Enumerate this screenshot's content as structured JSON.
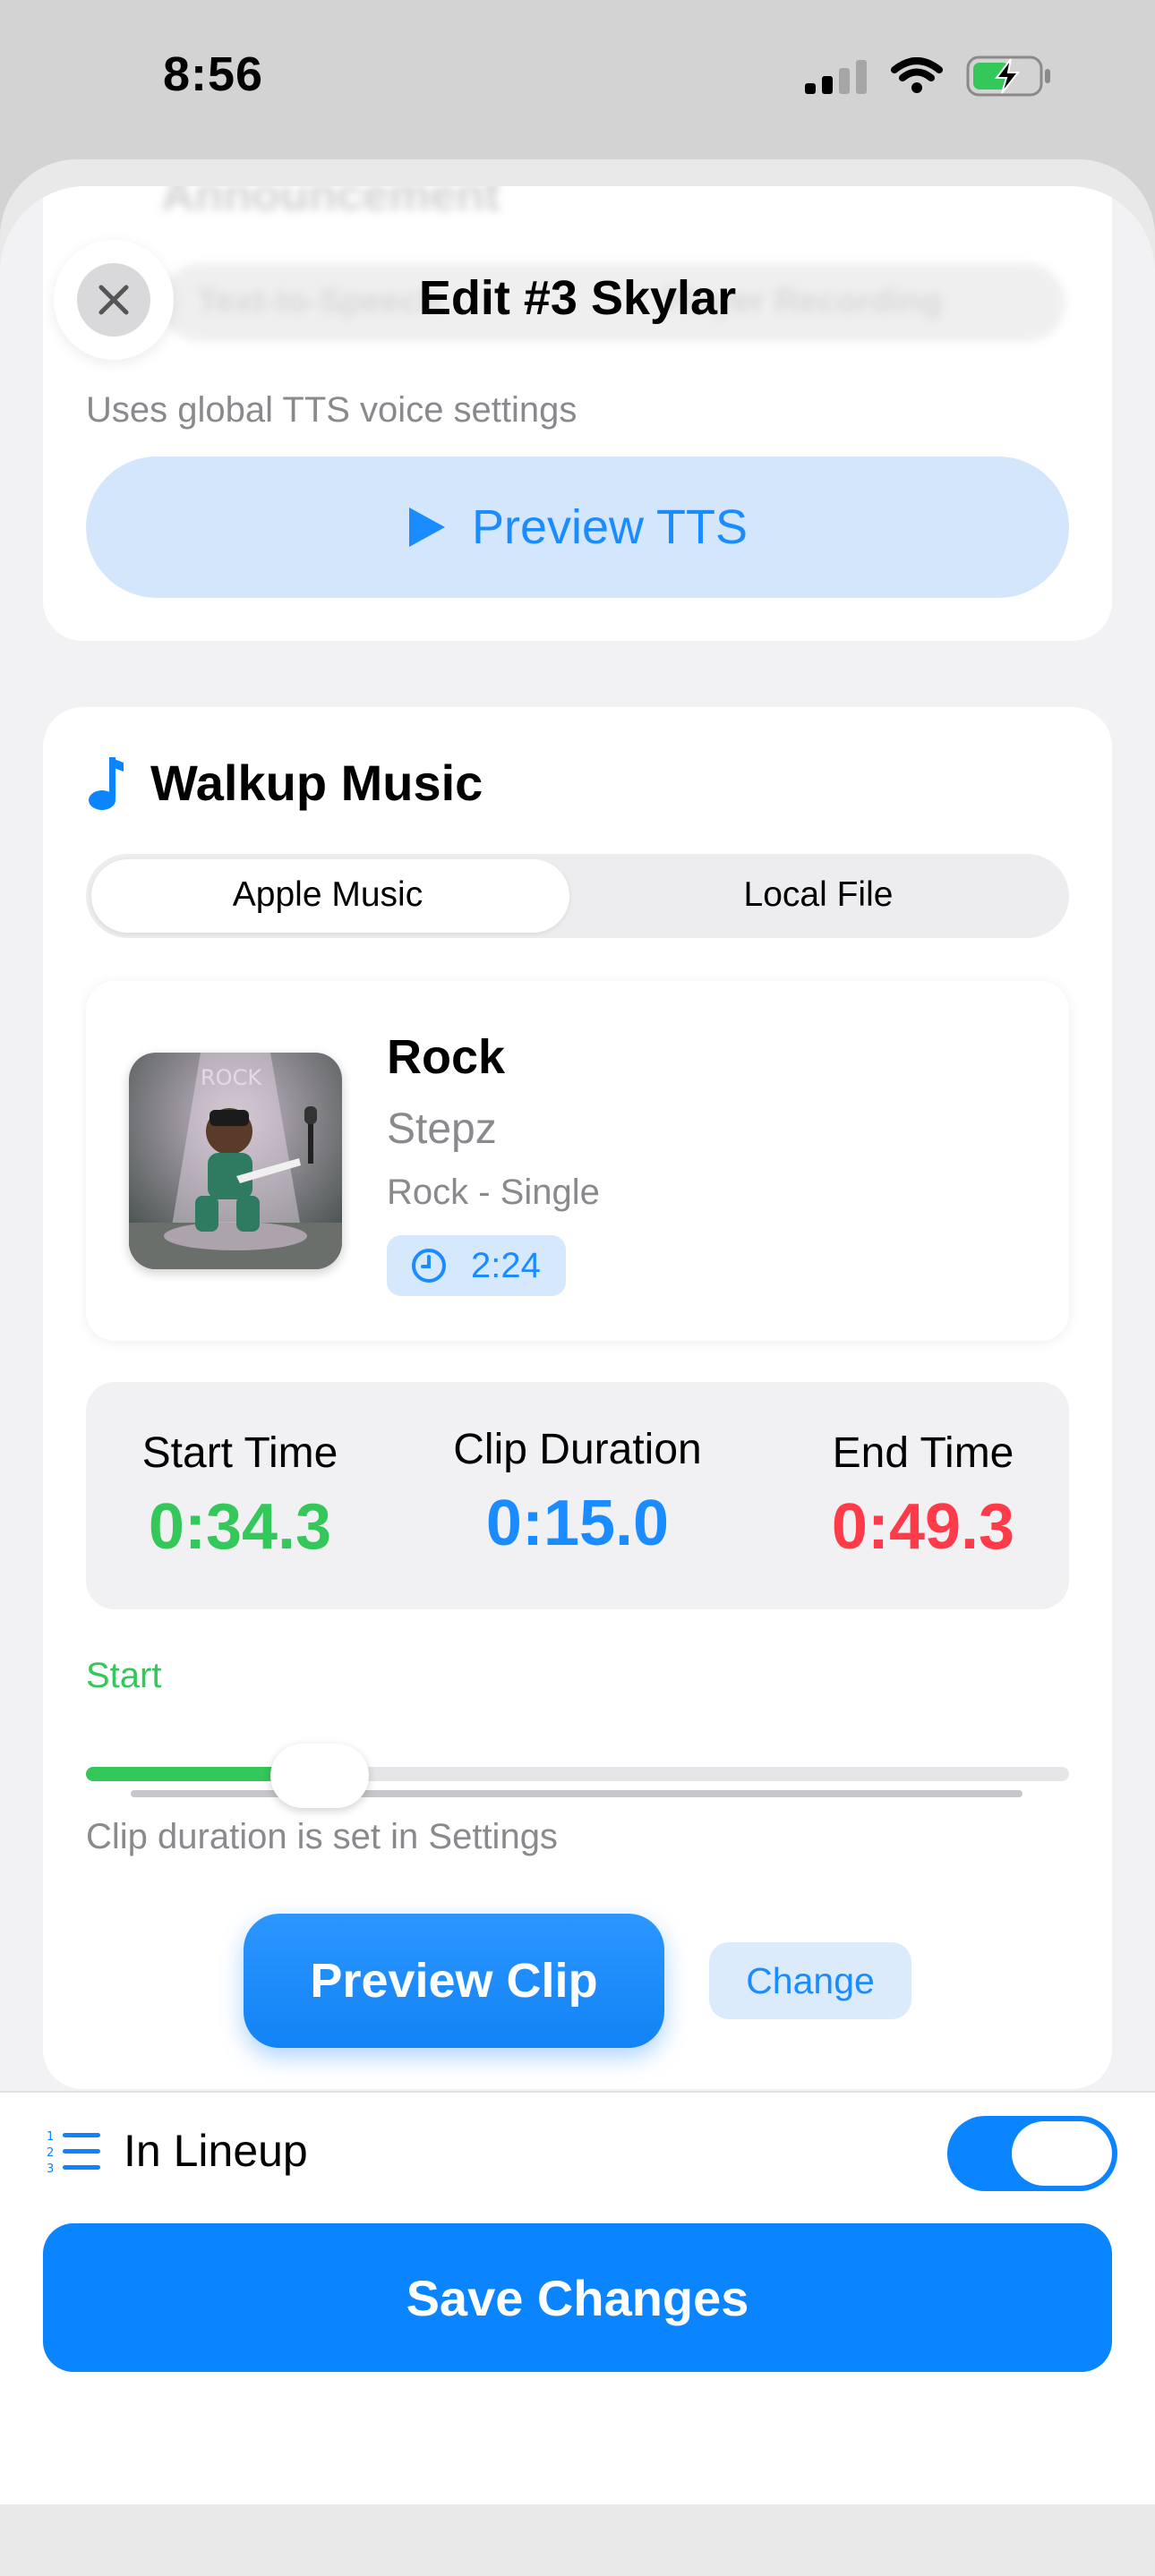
{
  "status_bar": {
    "time": "8:56"
  },
  "header": {
    "title": "Edit #3 Skylar",
    "behind_title": "Announcement",
    "behind_segment_left": "Text-to-Speech",
    "behind_segment_right": "Player Recording"
  },
  "announcement": {
    "note": "Uses global TTS voice settings",
    "preview_label": "Preview TTS"
  },
  "walkup": {
    "title": "Walkup Music",
    "segments": [
      "Apple Music",
      "Local File"
    ],
    "selected_segment": "Apple Music",
    "track": {
      "title": "Rock",
      "artist": "Stepz",
      "album": "Rock - Single",
      "duration": "2:24"
    },
    "times": {
      "start_label": "Start Time",
      "start_value": "0:34.3",
      "clip_label": "Clip Duration",
      "clip_value": "0:15.0",
      "end_label": "End Time",
      "end_value": "0:49.3"
    },
    "slider_label": "Start",
    "slider_fraction": 0.238,
    "duration_note": "Clip duration is set in Settings",
    "preview_clip_label": "Preview Clip",
    "change_label": "Change"
  },
  "footer": {
    "lineup_label": "In Lineup",
    "lineup_on": true,
    "save_label": "Save Changes"
  },
  "colors": {
    "accent": "#0A84FF",
    "start_green": "#34C759",
    "end_red": "#FF3B4A"
  }
}
